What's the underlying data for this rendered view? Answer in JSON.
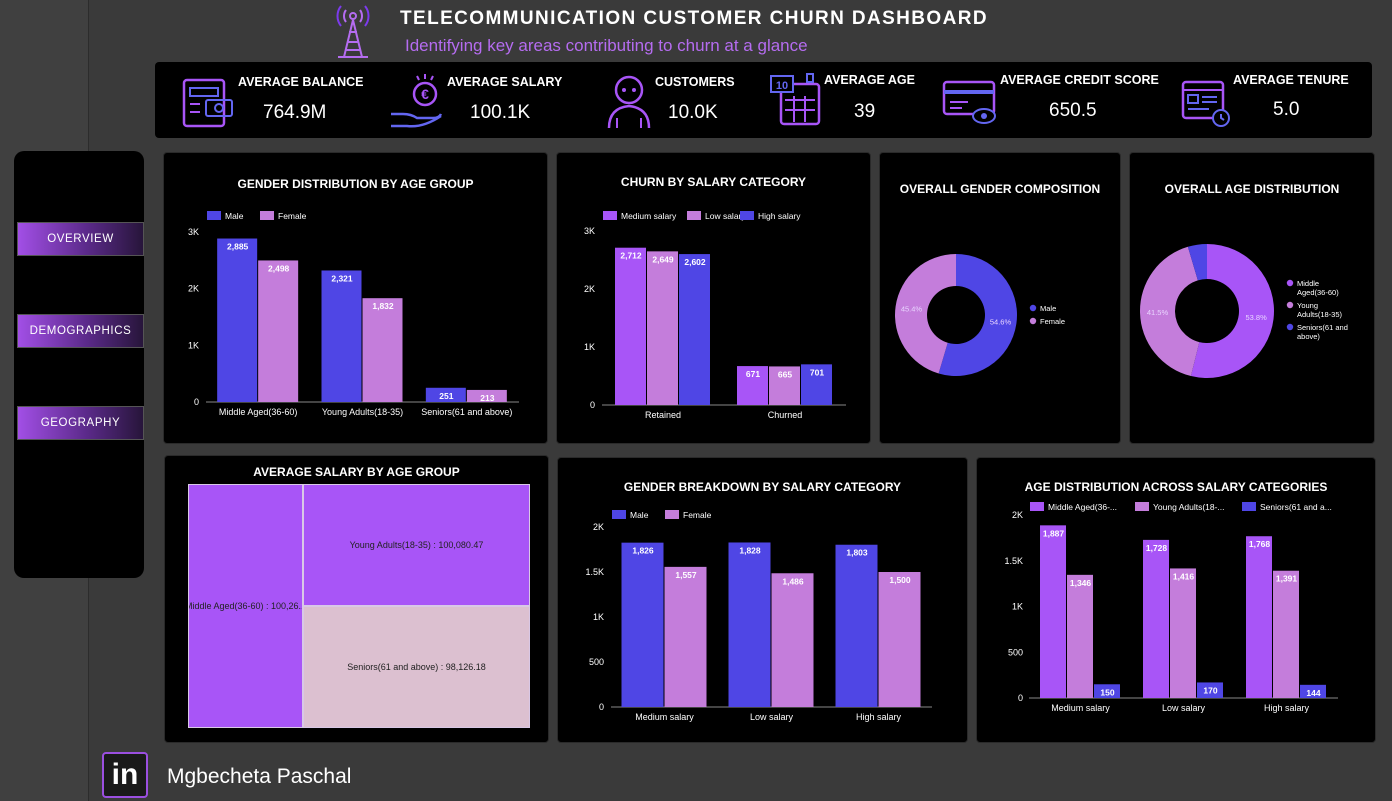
{
  "header": {
    "title": "TELECOMMUNICATION CUSTOMER CHURN DASHBOARD",
    "subtitle": "Identifying key areas contributing to churn at a glance"
  },
  "colors": {
    "male": "#4f46e5",
    "female": "#c47ddb",
    "medium": "#a855f7",
    "low": "#c47ddb",
    "high": "#4f46e5",
    "middle_aged": "#a855f7",
    "young": "#c47ddb",
    "seniors": "#4f46e5",
    "treemap_primary": "#a855f7",
    "treemap_light": "#dcc0d0",
    "accent": "#b56cf0"
  },
  "kpis": [
    {
      "label": "AVERAGE BALANCE",
      "value": "764.9M",
      "icon": "wallet-icon"
    },
    {
      "label": "AVERAGE SALARY",
      "value": "100.1K",
      "icon": "euro-hand-icon"
    },
    {
      "label": "CUSTOMERS",
      "value": "10.0K",
      "icon": "person-icon"
    },
    {
      "label": "AVERAGE AGE",
      "value": "39",
      "icon": "calendar-icon"
    },
    {
      "label": "AVERAGE CREDIT SCORE",
      "value": "650.5",
      "icon": "credit-card-icon"
    },
    {
      "label": "AVERAGE TENURE",
      "value": "5.0",
      "icon": "document-clock-icon"
    }
  ],
  "nav": {
    "items": [
      "OVERVIEW",
      "DEMOGRAPHICS",
      "GEOGRAPHY"
    ]
  },
  "footer": {
    "logo_text": "in",
    "name": "Mgbecheta Paschal"
  },
  "chart_data": [
    {
      "id": "gender_by_age",
      "type": "bar",
      "title": "GENDER DISTRIBUTION BY AGE GROUP",
      "categories": [
        "Middle Aged(36-60)",
        "Young Adults(18-35)",
        "Seniors(61 and above)"
      ],
      "series": [
        {
          "name": "Male",
          "values": [
            2885,
            2321,
            251
          ]
        },
        {
          "name": "Female",
          "values": [
            2498,
            1832,
            213
          ]
        }
      ],
      "data_labels": [
        [
          "2,885",
          "2,321",
          "251"
        ],
        [
          "2,498",
          "1,832",
          "213"
        ]
      ],
      "yticks": [
        "0",
        "1K",
        "2K",
        "3K"
      ],
      "ylim": [
        0,
        3000
      ],
      "legend": "top-left",
      "grid": false
    },
    {
      "id": "churn_by_salary",
      "type": "bar",
      "title": "CHURN BY SALARY CATEGORY",
      "categories": [
        "Retained",
        "Churned"
      ],
      "series": [
        {
          "name": "Medium salary",
          "values": [
            2712,
            671
          ]
        },
        {
          "name": "Low salary",
          "values": [
            2649,
            665
          ]
        },
        {
          "name": "High salary",
          "values": [
            2602,
            701
          ]
        }
      ],
      "data_labels": [
        [
          "2,712",
          "671"
        ],
        [
          "2,649",
          "665"
        ],
        [
          "2,602",
          "701"
        ]
      ],
      "yticks": [
        "0",
        "1K",
        "2K",
        "3K"
      ],
      "ylim": [
        0,
        3000
      ],
      "legend": "top-left",
      "grid": false
    },
    {
      "id": "gender_composition",
      "type": "pie",
      "title": "OVERALL GENDER COMPOSITION",
      "labels": [
        "Male",
        "Female"
      ],
      "values": [
        54.6,
        45.4
      ],
      "value_labels": [
        "54.6%",
        "45.4%"
      ],
      "donut": true,
      "legend": "right"
    },
    {
      "id": "age_distribution",
      "type": "pie",
      "title": "OVERALL AGE DISTRIBUTION",
      "labels": [
        "Middle Aged(36-60)",
        "Young Adults(18-35)",
        "Seniors(61 and above)"
      ],
      "legend_lines": [
        [
          "Middle",
          "Aged(36-60)"
        ],
        [
          "Young",
          "Adults(18-35)"
        ],
        [
          "Seniors(61 and",
          "above)"
        ]
      ],
      "values": [
        53.8,
        41.5,
        4.6
      ],
      "value_labels": [
        "53.8%",
        "41.5%",
        ""
      ],
      "donut": true,
      "legend": "right"
    },
    {
      "id": "avg_salary_by_age",
      "type": "treemap",
      "title": "AVERAGE SALARY BY AGE GROUP",
      "labels": [
        "Middle Aged(36-60) : 100,26...",
        "Young Adults(18-35) : 100,080.47",
        "Seniors(61 and above) : 98,126.18"
      ],
      "values": [
        100260,
        100080.47,
        98126.18
      ]
    },
    {
      "id": "gender_by_salary",
      "type": "bar",
      "title": "GENDER BREAKDOWN BY SALARY CATEGORY",
      "categories": [
        "Medium salary",
        "Low salary",
        "High salary"
      ],
      "series": [
        {
          "name": "Male",
          "values": [
            1826,
            1828,
            1803
          ]
        },
        {
          "name": "Female",
          "values": [
            1557,
            1486,
            1500
          ]
        }
      ],
      "data_labels": [
        [
          "1,826",
          "1,828",
          "1,803"
        ],
        [
          "1,557",
          "1,486",
          "1,500"
        ]
      ],
      "yticks": [
        "0",
        "500",
        "1K",
        "1.5K",
        "2K"
      ],
      "ylim": [
        0,
        2000
      ],
      "legend": "top-left",
      "grid": false
    },
    {
      "id": "age_across_salary",
      "type": "bar",
      "title": "AGE DISTRIBUTION ACROSS SALARY CATEGORIES",
      "categories": [
        "Medium salary",
        "Low salary",
        "High salary"
      ],
      "series": [
        {
          "name": "Middle Aged(36-...",
          "values": [
            1887,
            1728,
            1768
          ]
        },
        {
          "name": "Young Adults(18-...",
          "values": [
            1346,
            1416,
            1391
          ]
        },
        {
          "name": "Seniors(61 and a...",
          "values": [
            150,
            170,
            144
          ]
        }
      ],
      "data_labels": [
        [
          "1,887",
          "1,728",
          "1,768"
        ],
        [
          "1,346",
          "1,416",
          "1,391"
        ],
        [
          "150",
          "170",
          "144"
        ]
      ],
      "yticks": [
        "0",
        "500",
        "1K",
        "1.5K",
        "2K"
      ],
      "ylim": [
        0,
        2000
      ],
      "legend": "top-left",
      "grid": false
    }
  ]
}
